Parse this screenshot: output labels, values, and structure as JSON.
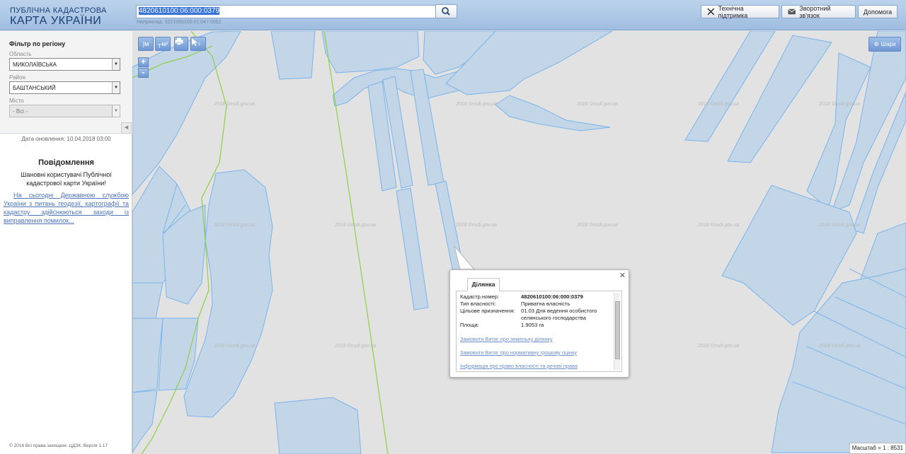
{
  "header": {
    "logo_line1": "ПУБЛІЧНА КАДАСТРОВА",
    "logo_line2": "КАРТА УКРАЇНИ",
    "search_value": "4820610100:06:000:0379",
    "search_hint": "Наприклад: 3221055100:01:047:0052",
    "buttons": {
      "support": "Технічна підтримка",
      "feedback": "Зворотний зв'язок",
      "help": "Допомога"
    }
  },
  "sidebar": {
    "filter_title": "Фільтр по регіону",
    "region_label": "Область",
    "region_value": "МИКОЛАЇВСЬКА",
    "district_label": "Район",
    "district_value": "БАШТАНСЬКИЙ",
    "city_label": "Місто",
    "city_value": "- Всі -",
    "update_date": "Дата оновлення: 10.04.2018 03:00",
    "notification_title": "Повідомлення",
    "notification_greeting": "Шановні користувачі Публічної кадастрової карти України!",
    "notification_link": "На сьогодні Державною службою України з питань геодезії, картографії та кадастру здійснюються заходи із виправлення помилок...",
    "copyright": "© 2016 Всі права захищені. ЦДЗК. Версія 1.17"
  },
  "map": {
    "layers_label": "Шари",
    "scale_text": "Масштаб = 1 : 8531",
    "watermark": "2018 ©nsdi.gov.ua"
  },
  "popup": {
    "tab_label": "Ділянка",
    "rows": [
      {
        "key": "Кадастр.номер:",
        "value": "4820610100:06:000:0379"
      },
      {
        "key": "Тип власності:",
        "value": "Приватна власність"
      },
      {
        "key": "Цільове призначення:",
        "value": "01.03 Для ведення особистого селянського господарства"
      },
      {
        "key": "Площа:",
        "value": "1.9053 га"
      }
    ],
    "links": [
      "Замовити Витяг про земельну ділянку",
      "Замовити Витяг про нормативну грошову оцінку",
      "Інформація про право власності та речові права"
    ]
  },
  "colors": {
    "parcel_fill": "#c2d6e8",
    "parcel_stroke": "#7ab4ea",
    "road_line": "#8fcf40",
    "map_bg": "#e2e2e2"
  }
}
